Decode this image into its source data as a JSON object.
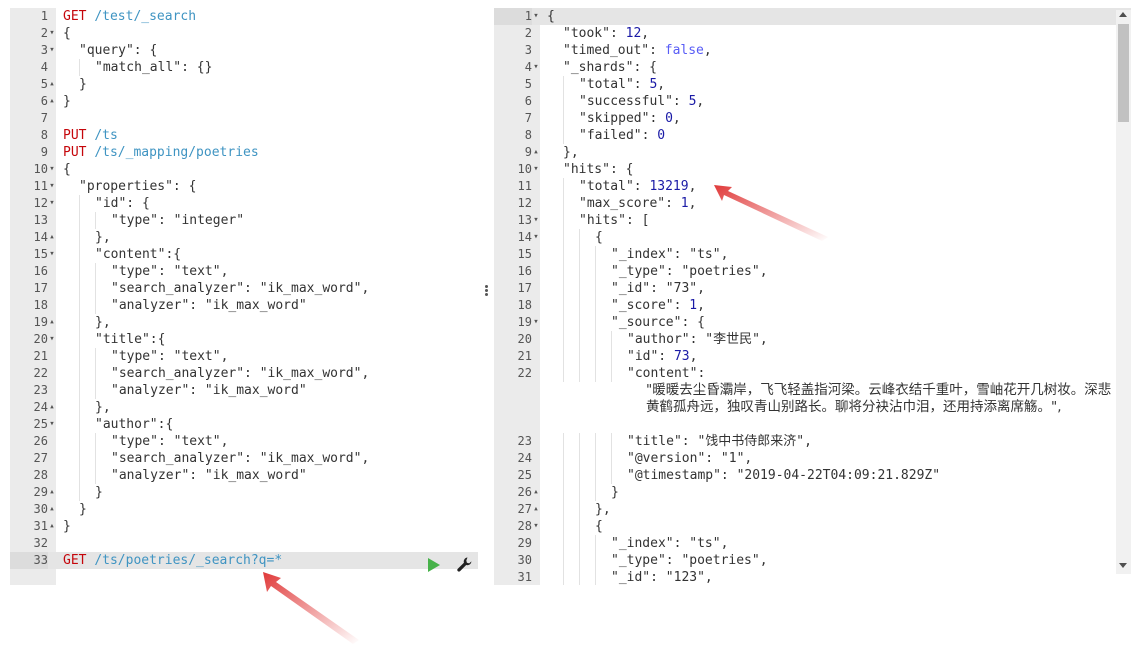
{
  "request_editor": {
    "lines": [
      {
        "n": "1",
        "fold": "",
        "parts": [
          [
            "GET ",
            "method"
          ],
          [
            "/test/_search",
            "url"
          ]
        ]
      },
      {
        "n": "2",
        "fold": "▾",
        "parts": [
          [
            "{",
            "punct"
          ]
        ]
      },
      {
        "n": "3",
        "fold": "▾",
        "indent": 1,
        "parts": [
          [
            "\"query\": {",
            "key"
          ]
        ]
      },
      {
        "n": "4",
        "fold": "",
        "indent": 2,
        "parts": [
          [
            "\"match_all\": {}",
            "key"
          ]
        ]
      },
      {
        "n": "5",
        "fold": "▴",
        "indent": 1,
        "parts": [
          [
            "}",
            "punct"
          ]
        ]
      },
      {
        "n": "6",
        "fold": "▴",
        "parts": [
          [
            "}",
            "punct"
          ]
        ]
      },
      {
        "n": "7",
        "fold": "",
        "parts": []
      },
      {
        "n": "8",
        "fold": "",
        "parts": [
          [
            "PUT ",
            "method"
          ],
          [
            "/ts",
            "url"
          ]
        ]
      },
      {
        "n": "9",
        "fold": "",
        "parts": [
          [
            "PUT ",
            "method"
          ],
          [
            "/ts/_mapping/poetries",
            "url"
          ]
        ]
      },
      {
        "n": "10",
        "fold": "▾",
        "parts": [
          [
            "{",
            "punct"
          ]
        ]
      },
      {
        "n": "11",
        "fold": "▾",
        "indent": 1,
        "parts": [
          [
            "\"properties\": {",
            "key"
          ]
        ]
      },
      {
        "n": "12",
        "fold": "▾",
        "indent": 2,
        "parts": [
          [
            "\"id\": {",
            "key"
          ]
        ]
      },
      {
        "n": "13",
        "fold": "",
        "indent": 3,
        "parts": [
          [
            "\"type\": \"integer\"",
            "key"
          ]
        ]
      },
      {
        "n": "14",
        "fold": "▴",
        "indent": 2,
        "parts": [
          [
            "},",
            "punct"
          ]
        ]
      },
      {
        "n": "15",
        "fold": "▾",
        "indent": 2,
        "parts": [
          [
            "\"content\":{",
            "key"
          ]
        ]
      },
      {
        "n": "16",
        "fold": "",
        "indent": 3,
        "parts": [
          [
            "\"type\": \"text\",",
            "key"
          ]
        ]
      },
      {
        "n": "17",
        "fold": "",
        "indent": 3,
        "parts": [
          [
            "\"search_analyzer\": \"ik_max_word\",",
            "key"
          ]
        ]
      },
      {
        "n": "18",
        "fold": "",
        "indent": 3,
        "parts": [
          [
            "\"analyzer\": \"ik_max_word\"",
            "key"
          ]
        ]
      },
      {
        "n": "19",
        "fold": "▴",
        "indent": 2,
        "parts": [
          [
            "},",
            "punct"
          ]
        ]
      },
      {
        "n": "20",
        "fold": "▾",
        "indent": 2,
        "parts": [
          [
            "\"title\":{",
            "key"
          ]
        ]
      },
      {
        "n": "21",
        "fold": "",
        "indent": 3,
        "parts": [
          [
            "\"type\": \"text\",",
            "key"
          ]
        ]
      },
      {
        "n": "22",
        "fold": "",
        "indent": 3,
        "parts": [
          [
            "\"search_analyzer\": \"ik_max_word\",",
            "key"
          ]
        ]
      },
      {
        "n": "23",
        "fold": "",
        "indent": 3,
        "parts": [
          [
            "\"analyzer\": \"ik_max_word\"",
            "key"
          ]
        ]
      },
      {
        "n": "24",
        "fold": "▴",
        "indent": 2,
        "parts": [
          [
            "},",
            "punct"
          ]
        ]
      },
      {
        "n": "25",
        "fold": "▾",
        "indent": 2,
        "parts": [
          [
            "\"author\":{",
            "key"
          ]
        ]
      },
      {
        "n": "26",
        "fold": "",
        "indent": 3,
        "parts": [
          [
            "\"type\": \"text\",",
            "key"
          ]
        ]
      },
      {
        "n": "27",
        "fold": "",
        "indent": 3,
        "parts": [
          [
            "\"search_analyzer\": \"ik_max_word\",",
            "key"
          ]
        ]
      },
      {
        "n": "28",
        "fold": "",
        "indent": 3,
        "parts": [
          [
            "\"analyzer\": \"ik_max_word\"",
            "key"
          ]
        ]
      },
      {
        "n": "29",
        "fold": "▴",
        "indent": 2,
        "parts": [
          [
            "}",
            "punct"
          ]
        ]
      },
      {
        "n": "30",
        "fold": "▴",
        "indent": 1,
        "parts": [
          [
            "}",
            "punct"
          ]
        ]
      },
      {
        "n": "31",
        "fold": "▴",
        "parts": [
          [
            "}",
            "punct"
          ]
        ]
      },
      {
        "n": "32",
        "fold": "",
        "parts": []
      },
      {
        "n": "33",
        "fold": "",
        "active": true,
        "parts": [
          [
            "GET ",
            "method"
          ],
          [
            "/ts/poetries/_search?q=*",
            "url"
          ]
        ]
      }
    ]
  },
  "response_viewer": {
    "lines": [
      {
        "n": "1",
        "fold": "▾",
        "active": true,
        "parts": [
          [
            "{",
            "punct"
          ]
        ]
      },
      {
        "n": "2",
        "fold": "",
        "indent": 1,
        "parts": [
          [
            "\"took\": ",
            "key"
          ],
          [
            "12",
            "num"
          ],
          [
            ",",
            "punct"
          ]
        ]
      },
      {
        "n": "3",
        "fold": "",
        "indent": 1,
        "parts": [
          [
            "\"timed_out\": ",
            "key"
          ],
          [
            "false",
            "bool"
          ],
          [
            ",",
            "punct"
          ]
        ]
      },
      {
        "n": "4",
        "fold": "▾",
        "indent": 1,
        "parts": [
          [
            "\"_shards\": {",
            "key"
          ]
        ]
      },
      {
        "n": "5",
        "fold": "",
        "indent": 2,
        "parts": [
          [
            "\"total\": ",
            "key"
          ],
          [
            "5",
            "num"
          ],
          [
            ",",
            "punct"
          ]
        ]
      },
      {
        "n": "6",
        "fold": "",
        "indent": 2,
        "parts": [
          [
            "\"successful\": ",
            "key"
          ],
          [
            "5",
            "num"
          ],
          [
            ",",
            "punct"
          ]
        ]
      },
      {
        "n": "7",
        "fold": "",
        "indent": 2,
        "parts": [
          [
            "\"skipped\": ",
            "key"
          ],
          [
            "0",
            "num"
          ],
          [
            ",",
            "punct"
          ]
        ]
      },
      {
        "n": "8",
        "fold": "",
        "indent": 2,
        "parts": [
          [
            "\"failed\": ",
            "key"
          ],
          [
            "0",
            "num"
          ]
        ]
      },
      {
        "n": "9",
        "fold": "▴",
        "indent": 1,
        "parts": [
          [
            "},",
            "punct"
          ]
        ]
      },
      {
        "n": "10",
        "fold": "▾",
        "indent": 1,
        "parts": [
          [
            "\"hits\": {",
            "key"
          ]
        ]
      },
      {
        "n": "11",
        "fold": "",
        "indent": 2,
        "parts": [
          [
            "\"total\": ",
            "key"
          ],
          [
            "13219",
            "num"
          ],
          [
            ",",
            "punct"
          ]
        ]
      },
      {
        "n": "12",
        "fold": "",
        "indent": 2,
        "parts": [
          [
            "\"max_score\": ",
            "key"
          ],
          [
            "1",
            "num"
          ],
          [
            ",",
            "punct"
          ]
        ]
      },
      {
        "n": "13",
        "fold": "▾",
        "indent": 2,
        "parts": [
          [
            "\"hits\": [",
            "key"
          ]
        ]
      },
      {
        "n": "14",
        "fold": "▾",
        "indent": 3,
        "parts": [
          [
            "{",
            "punct"
          ]
        ]
      },
      {
        "n": "15",
        "fold": "",
        "indent": 4,
        "parts": [
          [
            "\"_index\": \"ts\",",
            "key"
          ]
        ]
      },
      {
        "n": "16",
        "fold": "",
        "indent": 4,
        "parts": [
          [
            "\"_type\": \"poetries\",",
            "key"
          ]
        ]
      },
      {
        "n": "17",
        "fold": "",
        "indent": 4,
        "parts": [
          [
            "\"_id\": \"73\",",
            "key"
          ]
        ]
      },
      {
        "n": "18",
        "fold": "",
        "indent": 4,
        "parts": [
          [
            "\"_score\": ",
            "key"
          ],
          [
            "1",
            "num"
          ],
          [
            ",",
            "punct"
          ]
        ]
      },
      {
        "n": "19",
        "fold": "▾",
        "indent": 4,
        "parts": [
          [
            "\"_source\": {",
            "key"
          ]
        ]
      },
      {
        "n": "20",
        "fold": "",
        "indent": 5,
        "parts": [
          [
            "\"author\": \"李世民\",",
            "key"
          ]
        ]
      },
      {
        "n": "21",
        "fold": "",
        "indent": 5,
        "parts": [
          [
            "\"id\": ",
            "key"
          ],
          [
            "73",
            "num"
          ],
          [
            ",",
            "punct"
          ]
        ]
      },
      {
        "n": "22",
        "fold": "",
        "indent": 5,
        "parts": [
          [
            "\"content\":",
            "key"
          ]
        ],
        "wrapped": "\"暖暖去尘昏灞岸，飞飞轻盖指河梁。云峰衣结千重叶，雪岫花开几树妆。深悲黄鹤孤舟远，独叹青山别路长。聊将分袂沾巾泪，还用持添离席觞。\","
      },
      {
        "n": "23",
        "fold": "",
        "indent": 5,
        "parts": [
          [
            "\"title\": \"饯中书侍郎来济\",",
            "key"
          ]
        ]
      },
      {
        "n": "24",
        "fold": "",
        "indent": 5,
        "parts": [
          [
            "\"@version\": \"1\",",
            "key"
          ]
        ]
      },
      {
        "n": "25",
        "fold": "",
        "indent": 5,
        "parts": [
          [
            "\"@timestamp\": \"2019-04-22T04:09:21.829Z\"",
            "key"
          ]
        ]
      },
      {
        "n": "26",
        "fold": "▴",
        "indent": 4,
        "parts": [
          [
            "}",
            "punct"
          ]
        ]
      },
      {
        "n": "27",
        "fold": "▴",
        "indent": 3,
        "parts": [
          [
            "},",
            "punct"
          ]
        ]
      },
      {
        "n": "28",
        "fold": "▾",
        "indent": 3,
        "parts": [
          [
            "{",
            "punct"
          ]
        ]
      },
      {
        "n": "29",
        "fold": "",
        "indent": 4,
        "parts": [
          [
            "\"_index\": \"ts\",",
            "key"
          ]
        ]
      },
      {
        "n": "30",
        "fold": "",
        "indent": 4,
        "parts": [
          [
            "\"_type\": \"poetries\",",
            "key"
          ]
        ]
      },
      {
        "n": "31",
        "fold": "",
        "indent": 4,
        "parts": [
          [
            "\"_id\": \"123\",",
            "key"
          ]
        ]
      }
    ]
  },
  "icons": {
    "run": "play-icon",
    "settings": "wrench-icon",
    "resize": "vertical-dots-icon"
  },
  "colors": {
    "method": "#c5060b",
    "url": "#3f94c2",
    "number": "#1a1aa6",
    "boolean": "#585cf6",
    "run_button": "#47b24a",
    "annotation_arrow": "#e03a3a"
  }
}
